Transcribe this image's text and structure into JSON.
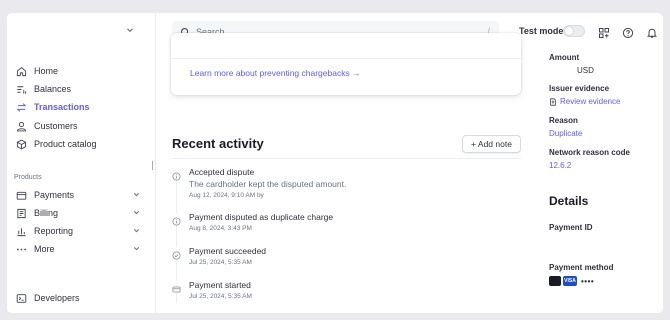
{
  "topbar": {
    "search_placeholder": "Search",
    "search_shortcut": "/",
    "test_mode_label": "Test mode",
    "test_mode_enabled": false
  },
  "sidebar": {
    "items": [
      {
        "label": "Home",
        "icon": "home-icon"
      },
      {
        "label": "Balances",
        "icon": "balances-icon"
      },
      {
        "label": "Transactions",
        "icon": "transactions-icon",
        "active": true
      },
      {
        "label": "Customers",
        "icon": "customers-icon"
      },
      {
        "label": "Product catalog",
        "icon": "product-catalog-icon"
      }
    ],
    "products_label": "Products",
    "product_items": [
      {
        "label": "Payments",
        "icon": "payments-icon"
      },
      {
        "label": "Billing",
        "icon": "billing-icon"
      },
      {
        "label": "Reporting",
        "icon": "reporting-icon"
      },
      {
        "label": "More",
        "icon": "more-icon"
      }
    ],
    "developers_label": "Developers"
  },
  "card": {
    "link_text": "Learn more about preventing chargebacks"
  },
  "recent_activity": {
    "title": "Recent activity",
    "add_note_label": "+ Add note",
    "events": [
      {
        "title": "Accepted dispute",
        "description": "The cardholder kept the disputed amount.",
        "time": "Aug 12, 2024, 9:10 AM by",
        "icon": "info-icon"
      },
      {
        "title": "Payment disputed as duplicate charge",
        "time": "Aug 8, 2024, 3:43 PM",
        "icon": "info-icon"
      },
      {
        "title": "Payment succeeded",
        "time": "Jul 25, 2024, 5:35 AM",
        "icon": "check-circle-icon"
      },
      {
        "title": "Payment started",
        "time": "Jul 25, 2024, 5:35 AM",
        "icon": "card-icon"
      }
    ]
  },
  "dispute_info": {
    "amount_label": "Amount",
    "amount_currency": "USD",
    "issuer_evidence_label": "Issuer evidence",
    "review_evidence_link": "Review evidence",
    "reason_label": "Reason",
    "reason_value": "Duplicate",
    "network_reason_code_label": "Network reason code",
    "network_reason_code_value": "12.6.2"
  },
  "details": {
    "title": "Details",
    "payment_id_label": "Payment ID",
    "payment_method_label": "Payment method",
    "card_brand": "VISA",
    "card_last4_mask": "••••"
  },
  "colors": {
    "accent": "#635bff",
    "text": "#30313d",
    "muted": "#6a7383"
  }
}
